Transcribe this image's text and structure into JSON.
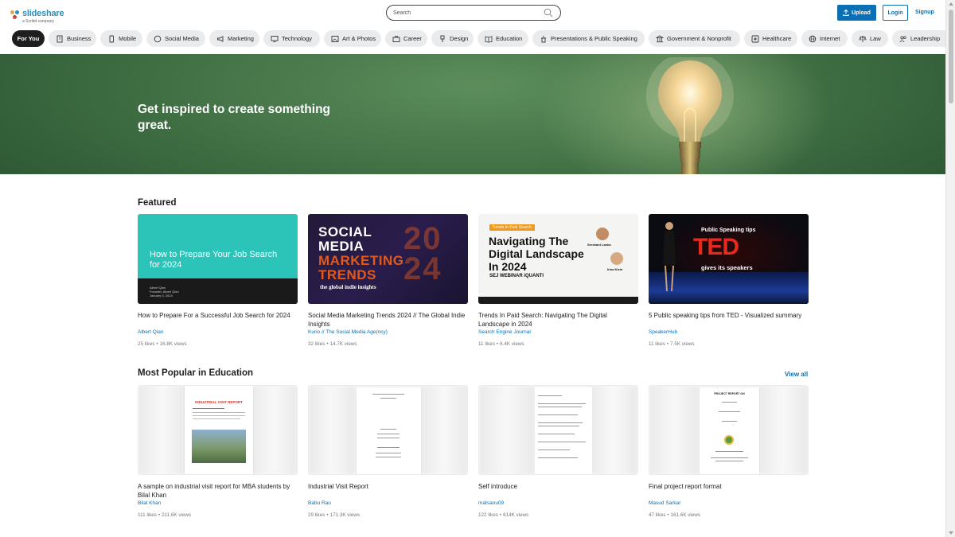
{
  "brand": {
    "name": "slideshare",
    "sub": "a Scribd company"
  },
  "header": {
    "search_placeholder": "Search",
    "upload_label": "Upload",
    "login_label": "Login",
    "signup_label": "Signup"
  },
  "categories": [
    {
      "label": "For You",
      "icon": "none"
    },
    {
      "label": "Business",
      "icon": "building-icon"
    },
    {
      "label": "Mobile",
      "icon": "mobile-icon"
    },
    {
      "label": "Social Media",
      "icon": "chat-icon"
    },
    {
      "label": "Marketing",
      "icon": "megaphone-icon"
    },
    {
      "label": "Technology",
      "icon": "monitor-icon"
    },
    {
      "label": "Art & Photos",
      "icon": "image-icon"
    },
    {
      "label": "Career",
      "icon": "briefcase-icon"
    },
    {
      "label": "Design",
      "icon": "brush-icon"
    },
    {
      "label": "Education",
      "icon": "book-icon"
    },
    {
      "label": "Presentations & Public Speaking",
      "icon": "podium-icon"
    },
    {
      "label": "Government & Nonprofit",
      "icon": "bank-icon"
    },
    {
      "label": "Healthcare",
      "icon": "medical-icon"
    },
    {
      "label": "Internet",
      "icon": "globe-icon"
    },
    {
      "label": "Law",
      "icon": "scales-icon"
    },
    {
      "label": "Leadership",
      "icon": "people-icon"
    }
  ],
  "hero": {
    "title": "Get inspired to create something great."
  },
  "featured": {
    "title": "Featured",
    "items": [
      {
        "title": "How to Prepare For a Successful Job Search for 2024",
        "author": "Albert Qian",
        "likes": "25 likes",
        "views": "16.8K views",
        "thumb": {
          "headline": "How to Prepare Your Job Search for 2024",
          "meta1": "Albert Qian",
          "meta2": "Founder, Albert Qian",
          "meta3": "January 5, 2024"
        }
      },
      {
        "title": "Social Media Marketing Trends 2024 // The Global Indie Insights",
        "author": "Kurio // The Social Media Age(ncy)",
        "likes": "32 likes",
        "views": "14.7K views",
        "thumb": {
          "l1": "SOCIAL",
          "l2": "MEDIA",
          "l3": "MARKETING",
          "l4": "TRENDS",
          "l5": "the global indie insights",
          "year": "20 24"
        }
      },
      {
        "title": "Trends In Paid Search: Navigating The Digital Landscape in 2024",
        "author": "Search Engine Journal",
        "likes": "11 likes",
        "views": "6.4K views",
        "thumb": {
          "tag": "Trends In Paid Search:",
          "headline": "Navigating The Digital Landscape In 2024",
          "logos": "SEJ WEBINAR  iQUANTI",
          "p1": "Sreekant Lanka",
          "p2": "Irina Klein"
        }
      },
      {
        "title": "5 Public speaking tips from TED - Visualized summary",
        "author": "SpeakerHub",
        "likes": "11 likes",
        "views": "7.5K views",
        "thumb": {
          "sub1": "Public Speaking tips",
          "ted": "TED",
          "sub2": "gives its speakers"
        }
      }
    ]
  },
  "popular": {
    "title": "Most Popular in Education",
    "view_all": "View all",
    "items": [
      {
        "title": "A sample on industrial visit report for MBA students by Bilal Khan",
        "author": "Bilal Khan",
        "likes": "111 likes",
        "views": "211.6K views",
        "thumb_heading": "INDUSTRIAL VISIT REPORT"
      },
      {
        "title": "Industrial Visit Report",
        "author": "Babu Rao",
        "likes": "29 likes",
        "views": "171.3K views"
      },
      {
        "title": "Self introduce",
        "author": "matsanu09",
        "likes": "122 likes",
        "views": "614K views"
      },
      {
        "title": "Final project report format",
        "author": "Masud Sarkar",
        "likes": "47 likes",
        "views": "161.6K views",
        "thumb_heading": "PROJECT REPORT ON"
      }
    ]
  },
  "colors": {
    "accent": "#0a6fb3",
    "brand": "#2a8fbd",
    "hero_green": "#4a7b4c"
  }
}
